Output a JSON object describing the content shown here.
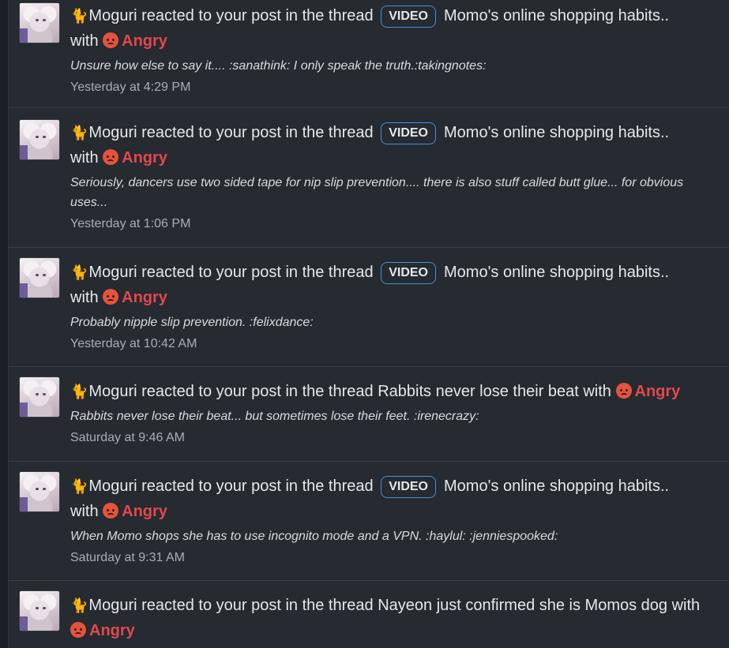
{
  "alerts": [
    {
      "user": "Moguri",
      "action": "reacted to your post in the thread",
      "badge": "VIDEO",
      "thread": "Momo's online shopping habits..",
      "with": "with",
      "reaction": "Angry",
      "snippet": "Unsure how else to say it.... :sanathink: I only speak the truth.:takingnotes:",
      "time": "Yesterday at 4:29 PM"
    },
    {
      "user": "Moguri",
      "action": "reacted to your post in the thread",
      "badge": "VIDEO",
      "thread": "Momo's online shopping habits..",
      "with": "with",
      "reaction": "Angry",
      "snippet": "Seriously, dancers use two sided tape for nip slip prevention.... there is also stuff called butt glue... for obvious uses...",
      "time": "Yesterday at 1:06 PM"
    },
    {
      "user": "Moguri",
      "action": "reacted to your post in the thread",
      "badge": "VIDEO",
      "thread": "Momo's online shopping habits..",
      "with": "with",
      "reaction": "Angry",
      "snippet": "Probably nipple slip prevention. :felixdance:",
      "time": "Yesterday at 10:42 AM"
    },
    {
      "user": "Moguri",
      "action": "reacted to your post in the thread",
      "thread": "Rabbits never lose their beat",
      "with": "with",
      "reaction": "Angry",
      "snippet": "Rabbits never lose their beat... but sometimes lose their feet. :irenecrazy:",
      "time": "Saturday at 9:46 AM"
    },
    {
      "user": "Moguri",
      "action": "reacted to your post in the thread",
      "badge": "VIDEO",
      "thread": "Momo's online shopping habits..",
      "with": "with",
      "reaction": "Angry",
      "snippet": "When Momo shops she has to use incognito mode and a VPN. :haylul: :jenniespooked:",
      "time": "Saturday at 9:31 AM"
    },
    {
      "user": "Moguri",
      "action": "reacted to your post in the thread",
      "thread": "Nayeon just confirmed she is Momos dog",
      "with": "with",
      "reaction": "Angry"
    }
  ],
  "icons": {
    "user_icon": "cat-icon",
    "reaction_icon": "angry-face-icon"
  },
  "colors": {
    "background": "#262a31",
    "angry": "#e2484d",
    "badge_border": "#4a90d9",
    "timestamp": "#a8adb5"
  }
}
